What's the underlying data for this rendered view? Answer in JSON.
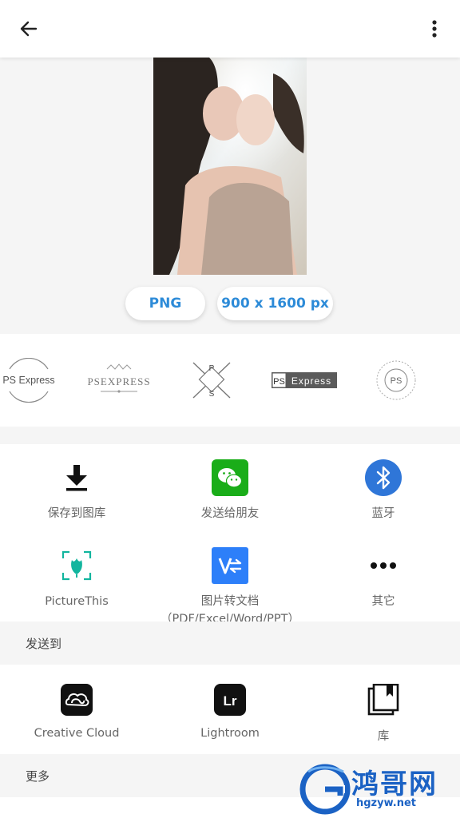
{
  "topbar": {
    "back_icon": "arrow-left-icon",
    "menu_icon": "more-vertical-icon"
  },
  "preview": {
    "format": "PNG",
    "dimensions": "900 x 1600 px"
  },
  "watermarks": [
    {
      "text": "PS Express"
    },
    {
      "text": "PSEXPRESS"
    },
    {
      "text_top": "P",
      "text_bottom": "S"
    },
    {
      "text_left": "PS",
      "text_right": "Express"
    },
    {
      "text": "PS"
    }
  ],
  "share": [
    {
      "label": "保存到图库",
      "icon": "download-icon"
    },
    {
      "label": "发送给朋友",
      "icon": "wechat-icon",
      "color": "#1aad19"
    },
    {
      "label": "蓝牙",
      "icon": "bluetooth-icon",
      "color": "#2f76d8"
    },
    {
      "label": "PictureThis",
      "icon": "picturethis-icon",
      "color": "#12b59e"
    },
    {
      "label": "图片转文档（PDF/Excel/Word/PPT）",
      "icon": "doc-convert-icon",
      "color": "#2d7ff9"
    },
    {
      "label": "其它",
      "icon": "more-horizontal-icon"
    }
  ],
  "sections": {
    "send_to": "发送到",
    "more": "更多"
  },
  "apps": [
    {
      "label": "Creative Cloud",
      "icon": "creative-cloud-icon",
      "letters": ""
    },
    {
      "label": "Lightroom",
      "icon": "lightroom-icon",
      "letters": "Lr"
    },
    {
      "label": "库",
      "icon": "library-icon"
    }
  ],
  "site_logo": {
    "name": "鸿哥网",
    "url": "hgzyw.net",
    "color": "#1b62c4"
  }
}
